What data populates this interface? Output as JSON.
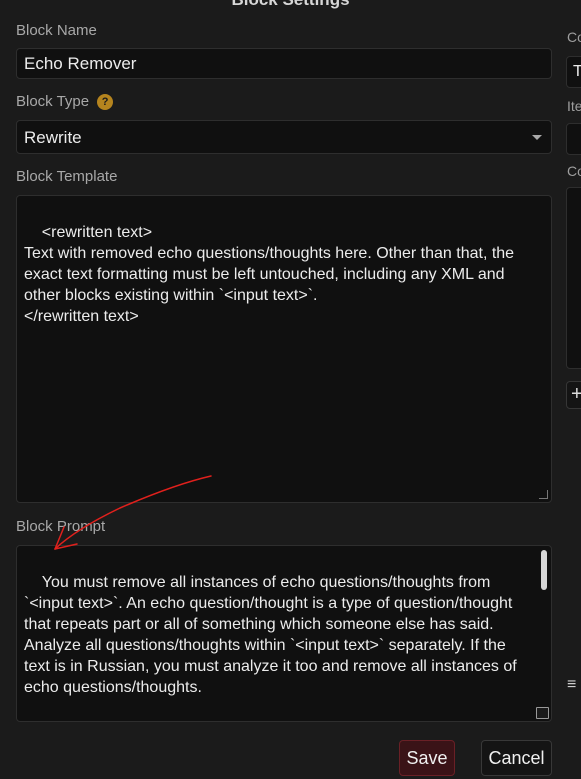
{
  "dialog": {
    "title": "Block Settings"
  },
  "fields": {
    "block_name_label": "Block Name",
    "block_name_value": "Echo Remover",
    "block_type_label": "Block Type",
    "block_type_help": "?",
    "block_type_value": "Rewrite",
    "block_template_label": "Block Template",
    "block_template_value": "<rewritten text>\nText with removed echo questions/thoughts here. Other than that, the exact text formatting must be left untouched, including any XML and other blocks existing within `<input text>`.\n</rewritten text>",
    "block_prompt_label": "Block Prompt",
    "block_prompt_value": "You must remove all instances of echo questions/thoughts from `<input text>`. An echo question/thought is a type of question/thought that repeats part or all of something which someone else has said. Analyze all questions/thoughts within `<input text>` separately. If the text is in Russian, you must analyze it too and remove all instances of echo questions/thoughts."
  },
  "buttons": {
    "save": "Save",
    "cancel": "Cancel"
  },
  "right_panel": {
    "label_1": "Co",
    "value_1": "T",
    "label_2": "Ite",
    "label_3": "Co",
    "add_button": "+",
    "menu_icon": "≡"
  },
  "colors": {
    "save_button": "#3a1317",
    "help_icon": "#b5841e",
    "annotation_arrow": "#e0201c"
  }
}
